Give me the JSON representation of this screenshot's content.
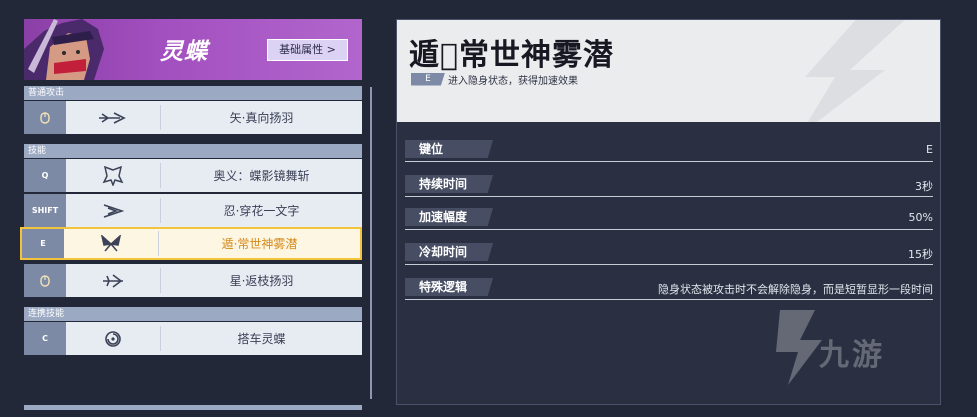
{
  "hero": {
    "name": "灵蝶",
    "attr_button": "基础属性 >"
  },
  "sections": {
    "basic": "普通攻击",
    "skills": "技能",
    "combo": "连携技能"
  },
  "rows": [
    {
      "key": "",
      "icon": "arrow-feather-icon",
      "name": "矢·真向扬羽"
    },
    {
      "key": "Q",
      "icon": "butterfly-mask-icon",
      "name": "奥义：蝶影镜舞斩"
    },
    {
      "key": "SHIFT",
      "icon": "wing-slash-icon",
      "name": "忍·穿花一文字"
    },
    {
      "key": "E",
      "icon": "butterfly-icon",
      "name": "遁·常世神雾潜"
    },
    {
      "key": "",
      "icon": "star-feather-icon",
      "name": "星·返枝扬羽"
    },
    {
      "key": "C",
      "icon": "swirl-icon",
      "name": "搭车灵蝶"
    }
  ],
  "detail": {
    "title": "遁􀀀常世神雾潜",
    "key": "E",
    "description": "进入隐身状态，获得加速效果",
    "props": [
      {
        "label": "键位",
        "value": "E"
      },
      {
        "label": "持续时间",
        "value": "3秒"
      },
      {
        "label": "加速幅度",
        "value": "50%"
      },
      {
        "label": "冷却时间",
        "value": "15秒"
      },
      {
        "label": "特殊逻辑",
        "value": "隐身状态被攻击时不会解除隐身，而是短暂显形一段时间"
      }
    ]
  },
  "watermark": "九游",
  "colors": {
    "hero_bg": "#a24fbf",
    "active_border": "#f1c43b",
    "active_text": "#d58a1a",
    "section_bg": "#9ba9c3"
  }
}
